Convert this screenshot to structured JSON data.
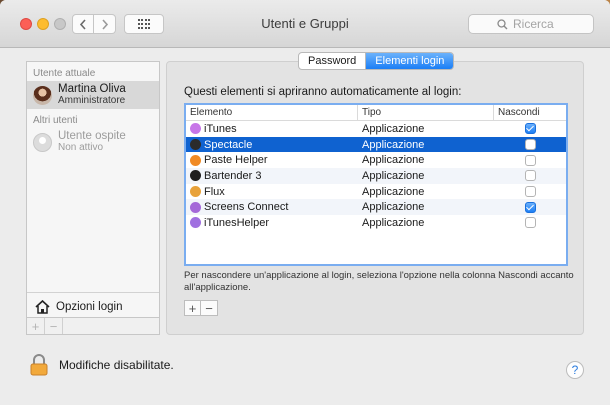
{
  "window": {
    "title": "Utenti e Gruppi",
    "search_placeholder": "Ricerca"
  },
  "users": {
    "current_section": "Utente attuale",
    "current_user": {
      "name": "Martina Oliva",
      "role": "Amministratore"
    },
    "other_section": "Altri utenti",
    "guest_user": {
      "name": "Utente ospite",
      "role": "Non attivo"
    },
    "login_options": "Opzioni login",
    "add_label": "+",
    "remove_label": "−"
  },
  "tabs": {
    "password": "Password",
    "login_items": "Elementi login"
  },
  "login_items": {
    "intro": "Questi elementi si apriranno automaticamente al login:",
    "columns": [
      "Elemento",
      "Tipo",
      "Nascondi"
    ],
    "rows": [
      {
        "name": "iTunes",
        "type": "Applicazione",
        "hidden": true,
        "icon": "itunes-icon",
        "color": "#c776e8"
      },
      {
        "name": "Spectacle",
        "type": "Applicazione",
        "hidden": false,
        "icon": "spectacle-icon",
        "color": "#2b2b2b",
        "selected": true
      },
      {
        "name": "Paste Helper",
        "type": "Applicazione",
        "hidden": false,
        "icon": "paste-icon",
        "color": "#f08a24"
      },
      {
        "name": "Bartender 3",
        "type": "Applicazione",
        "hidden": false,
        "icon": "bartender-icon",
        "color": "#1f1f1f"
      },
      {
        "name": "Flux",
        "type": "Applicazione",
        "hidden": false,
        "icon": "flux-icon",
        "color": "#e8a23a"
      },
      {
        "name": "Screens Connect",
        "type": "Applicazione",
        "hidden": true,
        "icon": "screens-icon",
        "color": "#a468d8"
      },
      {
        "name": "iTunesHelper",
        "type": "Applicazione",
        "hidden": false,
        "icon": "itunes-helper-icon",
        "color": "#a070e0"
      }
    ],
    "note": "Per nascondere un'applicazione al login, seleziona l'opzione nella colonna Nascondi accanto all'applicazione.",
    "add_label": "+",
    "remove_label": "−"
  },
  "footer": {
    "lock_text": "Modifiche disabilitate.",
    "help_label": "?"
  },
  "colors": {
    "accent": "#1b7ef6",
    "selection": "#0f62d0"
  }
}
